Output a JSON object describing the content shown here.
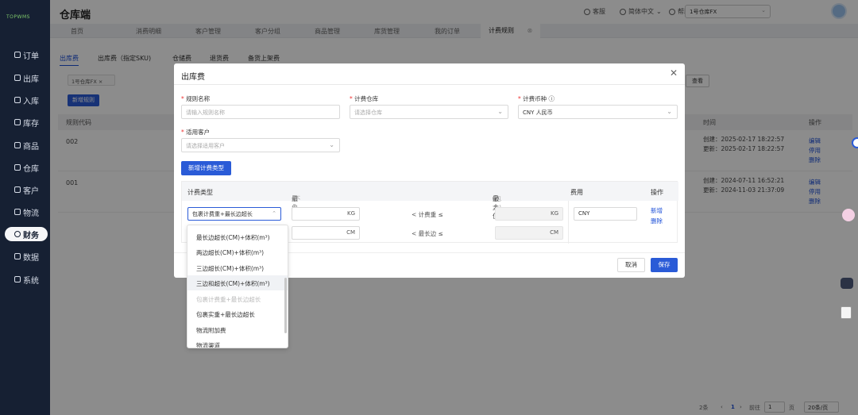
{
  "sidebar": {
    "logo": "TOPWMS",
    "items": [
      {
        "label": "订单",
        "icon": "order-icon"
      },
      {
        "label": "出库",
        "icon": "outbound-icon"
      },
      {
        "label": "入库",
        "icon": "inbound-icon"
      },
      {
        "label": "库存",
        "icon": "inventory-icon"
      },
      {
        "label": "商品",
        "icon": "product-icon"
      },
      {
        "label": "仓库",
        "icon": "warehouse-icon"
      },
      {
        "label": "客户",
        "icon": "customer-icon"
      },
      {
        "label": "物流",
        "icon": "logistics-icon"
      },
      {
        "label": "财务",
        "icon": "finance-icon",
        "active": true
      },
      {
        "label": "数据",
        "icon": "data-icon"
      },
      {
        "label": "系统",
        "icon": "system-icon"
      }
    ]
  },
  "header": {
    "title": "仓库端",
    "customer_service": "客服",
    "language": "简体中文",
    "help_center": "帮助中心",
    "warehouse": "1号仓库FX"
  },
  "tabs": [
    "首页",
    "消费明细",
    "客户管理",
    "客户分组",
    "商品管理",
    "库货管理",
    "我的订单",
    "计费规则"
  ],
  "subtabs": [
    "出库费",
    "出库费（指定SKU)",
    "仓储费",
    "退货费",
    "备货上架费"
  ],
  "filter": {
    "chip": "1号仓库FX",
    "search": "查看"
  },
  "new_rule_button": "新增规则",
  "table": {
    "headers": {
      "code": "规则代码",
      "time": "时间",
      "ops": "操作"
    },
    "rows": [
      {
        "code": "002",
        "created": "创建：2025-02-17 18:22:57",
        "updated": "更新：2025-02-17 18:22:57",
        "ops": [
          "编辑",
          "停用",
          "删除"
        ]
      },
      {
        "code": "001",
        "created": "创建：2024-07-11 16:52:21",
        "updated": "更新：2024-11-03 21:37:09",
        "ops": [
          "编辑",
          "停用",
          "删除"
        ]
      }
    ]
  },
  "pager": {
    "total": "2条",
    "page": "1",
    "goto": "前往",
    "goto_value": "1",
    "page_unit": "页",
    "per_page": "20条/页"
  },
  "modal": {
    "title": "出库费",
    "fields": {
      "rule_name": {
        "label": "规则名称",
        "placeholder": "请输入规则名称"
      },
      "warehouse": {
        "label": "计费仓库",
        "placeholder": "请选择仓库"
      },
      "currency": {
        "label": "计费币种",
        "value": "CNY 人民币"
      },
      "customer": {
        "label": "适用客户",
        "placeholder": "请选择适用客户"
      }
    },
    "add_type_button": "新增计费类型",
    "rule_table": {
      "headers": {
        "type": "计费类型",
        "min": "最小值",
        "min_note": "(不包含)",
        "max": "最大值",
        "max_note": "(包含)",
        "fee": "费用",
        "ops": "操作"
      },
      "type_value": "包裹计费重+最长边超长",
      "rows": [
        {
          "min_unit": "KG",
          "cond": "< 计费重 ≤",
          "max_unit": "KG"
        },
        {
          "min_unit": "CM",
          "cond": "< 最长边 ≤",
          "max_unit": "CM"
        }
      ],
      "fee": "CNY",
      "ops": [
        "新增",
        "删除"
      ]
    },
    "cancel": "取消",
    "save": "保存"
  },
  "dropdown": {
    "options": [
      {
        "label": "最长边超长(CM)+体积(m³)"
      },
      {
        "label": "两边超长(CM)+体积(m³)"
      },
      {
        "label": "三边超长(CM)+体积(m³)"
      },
      {
        "label": "三边和超长(CM)+体积(m³)",
        "hover": true
      },
      {
        "label": "包裹计费重+最长边超长",
        "disabled": true
      },
      {
        "label": "包裹实重+最长边超长"
      },
      {
        "label": "物流附加费"
      },
      {
        "label": "物流渠道"
      }
    ]
  }
}
